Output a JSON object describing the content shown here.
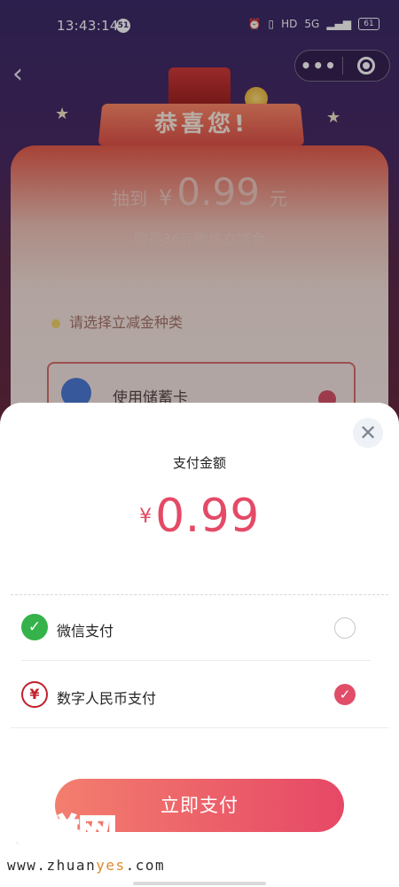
{
  "status_bar": {
    "time": "13:43:14",
    "notification_count": "51",
    "network": "5G",
    "hd": "HD",
    "battery": "61"
  },
  "background": {
    "banner": "恭喜您!",
    "won_prefix": "抽到",
    "won_currency": "¥",
    "won_amount": "0.99",
    "won_unit": "元",
    "subtitle": "购买36元微信立减金",
    "choose_type": "请选择立减金种类",
    "debit_card_option": "使用储蓄卡"
  },
  "sheet": {
    "title": "支付金额",
    "currency": "¥",
    "amount": "0.99",
    "methods": [
      {
        "label": "微信支付",
        "icon": "wechat-pay-icon",
        "selected": false
      },
      {
        "label": "数字人民币支付",
        "icon": "e-cny-icon",
        "selected": true
      }
    ],
    "pay_button": "立即支付"
  },
  "watermark": {
    "brand": "好赚网",
    "url_prefix": "www.zhuan",
    "url_highlight": "yes",
    "url_suffix": ".com"
  },
  "colors": {
    "accent": "#e44a66",
    "wechat_green": "#35b24a",
    "ecny_red": "#c0202d"
  }
}
